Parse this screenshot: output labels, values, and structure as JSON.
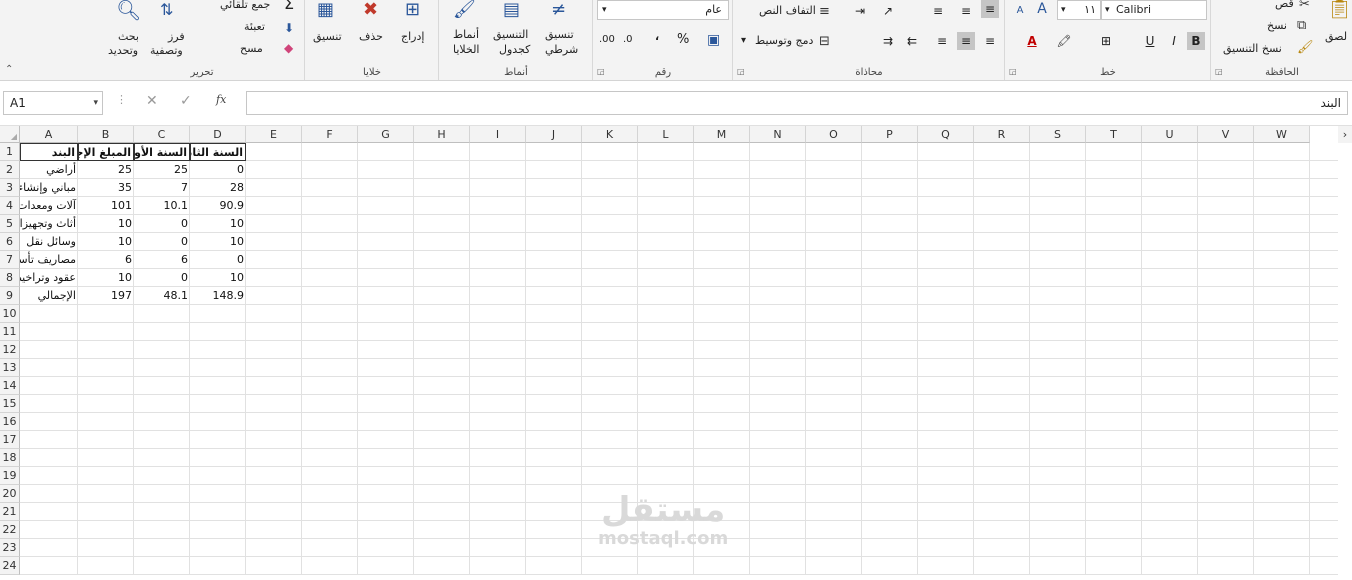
{
  "ribbon": {
    "editing": {
      "group": "تحرير",
      "autosum": "جمع تلقائي",
      "fill": "تعبئة",
      "clear": "مسح",
      "sort_filter_1": "فرز",
      "sort_filter_2": "وتصفية",
      "find_1": "بحث",
      "find_2": "وتحديد"
    },
    "cells": {
      "group": "خلايا",
      "format": "تنسيق",
      "delete": "حذف",
      "insert": "إدراج"
    },
    "styles": {
      "group": "أنماط",
      "cell_styles_1": "أنماط",
      "cell_styles_2": "الخلايا",
      "format_table_1": "التنسيق",
      "format_table_2": "كجدول",
      "conditional_1": "تنسيق",
      "conditional_2": "شرطي"
    },
    "number": {
      "group": "رقم",
      "format_value": "عام",
      "percent": "%",
      "comma": "،",
      "inc_decimal": ".00",
      "dec_decimal": ".0"
    },
    "alignment": {
      "group": "محاذاة",
      "wrap": "التفاف النص",
      "merge": "دمج وتوسيط"
    },
    "font": {
      "group": "خط",
      "name": "Calibri",
      "size": "١١",
      "bold": "B",
      "italic": "I",
      "underline": "U",
      "grow": "A",
      "shrink": "A"
    },
    "clipboard": {
      "group": "الحافظة",
      "cut": "قص",
      "copy": "نسخ",
      "format_painter": "نسخ التنسيق",
      "paste": "لصق"
    }
  },
  "formula_bar": {
    "name_box": "A1",
    "fx": "fx",
    "content": "البند"
  },
  "columns": [
    "A",
    "B",
    "C",
    "D",
    "E",
    "F",
    "G",
    "H",
    "I",
    "J",
    "K",
    "L",
    "M",
    "N",
    "O",
    "P",
    "Q",
    "R",
    "S",
    "T",
    "U",
    "V",
    "W"
  ],
  "rows": [
    "1",
    "2",
    "3",
    "4",
    "5",
    "6",
    "7",
    "8",
    "9",
    "10",
    "11",
    "12",
    "13",
    "14",
    "15",
    "16",
    "17",
    "18",
    "19",
    "20",
    "21",
    "22",
    "23",
    "24"
  ],
  "table": {
    "headers": [
      "البند",
      "المبلغ الإجمالي (مليون جنيه)",
      "السنة الأولى",
      "السنة الثانية"
    ],
    "data": [
      [
        "أراضي",
        "25",
        "25",
        "0"
      ],
      [
        "مباني وإنشاءات",
        "35",
        "7",
        "28"
      ],
      [
        "آلات ومعدات",
        "101",
        "10.1",
        "90.9"
      ],
      [
        "أثاث وتجهيزات",
        "10",
        "0",
        "10"
      ],
      [
        "وسائل نقل",
        "10",
        "0",
        "10"
      ],
      [
        "مصاريف تأسيس",
        "6",
        "6",
        "0"
      ],
      [
        "عقود وتراخيص",
        "10",
        "0",
        "10"
      ],
      [
        "الإجمالي",
        "197",
        "48.1",
        "148.9"
      ]
    ]
  },
  "watermark": {
    "arabic": "مستقل",
    "latin": "mostaql.com"
  },
  "colors": {
    "accent": "#2b579a",
    "font_red": "#c00000",
    "highlight": "#ffff00"
  }
}
